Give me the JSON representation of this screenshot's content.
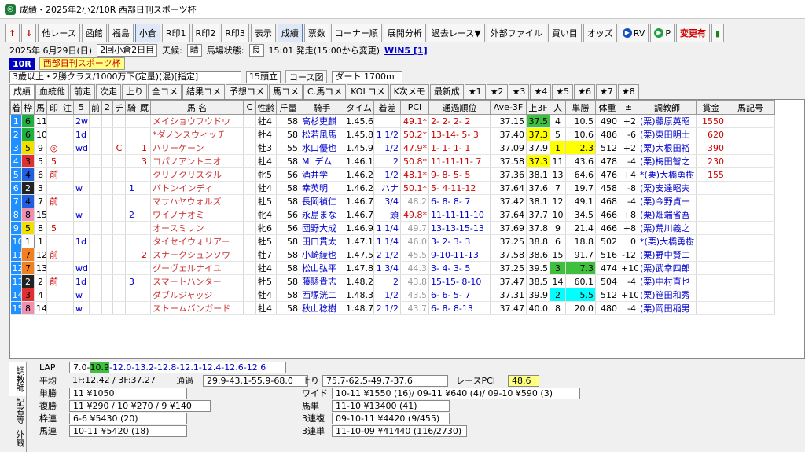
{
  "window": {
    "title": "成績・2025年2小2/10R 西部日刊スポーツ杯"
  },
  "toolbar": [
    {
      "id": "prev",
      "label": "↑",
      "icon": "up-arrow-icon"
    },
    {
      "id": "next",
      "label": "↓",
      "icon": "down-arrow-icon"
    },
    {
      "id": "other_race",
      "label": "他レース"
    },
    {
      "id": "hakodate",
      "label": "函館"
    },
    {
      "id": "fukushima",
      "label": "福島"
    },
    {
      "id": "kokura",
      "label": "小倉",
      "active": true
    },
    {
      "id": "rmark1",
      "label": "R印1"
    },
    {
      "id": "rmark2",
      "label": "R印2"
    },
    {
      "id": "rmark3",
      "label": "R印3"
    },
    {
      "id": "display",
      "label": "表示"
    },
    {
      "id": "results",
      "label": "成績",
      "active": true
    },
    {
      "id": "votes",
      "label": "票数"
    },
    {
      "id": "corner",
      "label": "コーナー順"
    },
    {
      "id": "pace",
      "label": "展開分析"
    },
    {
      "id": "past",
      "label": "過去レース▼"
    },
    {
      "id": "extfile",
      "label": "外部ファイル"
    },
    {
      "id": "buy",
      "label": "買い目"
    },
    {
      "id": "odds",
      "label": "オッズ"
    },
    {
      "id": "rv",
      "label": "RV",
      "icon": "play-circle-icon"
    },
    {
      "id": "p",
      "label": "P",
      "icon": "play-green-icon"
    },
    {
      "id": "changed",
      "label": "変更有"
    },
    {
      "id": "flag",
      "label": "",
      "icon": "flag-icon"
    }
  ],
  "info": {
    "date": "2025年 6月29日(日)",
    "meeting": "2回小倉2日目",
    "weather_label": "天候:",
    "weather": "晴",
    "track_label": "馬場状態:",
    "track": "良",
    "start": "15:01 発走(15:00から変更)",
    "win5": "WIN5 [1]"
  },
  "race": {
    "no": "10R",
    "name": "西部日刊スポーツ杯",
    "cond": "3歳以上・2勝クラス/1000万下(定量)(混)[指定]",
    "runners": "15頭立",
    "course_btn": "コース図",
    "course": "ダート 1700m"
  },
  "tabs": [
    "成績",
    "血統他",
    "前走",
    "次走",
    "上り",
    "全コメ",
    "結果コメ",
    "予想コメ",
    "馬コメ",
    "C.馬コメ",
    "KOLコメ",
    "K次メモ",
    "最新成",
    "★1",
    "★2",
    "★3",
    "★4",
    "★5",
    "★6",
    "★7",
    "★8"
  ],
  "columns": [
    "着",
    "枠",
    "馬",
    "印",
    "注",
    "5",
    "前",
    "2",
    "チ",
    "騎",
    "厩",
    "馬 名",
    "C",
    "性齢",
    "斤量",
    "騎手",
    "タイム",
    "着差",
    "PCI",
    "通過順位",
    "Ave-3F",
    "上3F",
    "人",
    "単勝",
    "体重",
    "±",
    "調教師",
    "賞金",
    "馬記号"
  ],
  "rows": [
    [
      "1",
      "6",
      "11",
      "",
      "",
      "2w",
      "",
      "",
      "",
      "",
      "",
      "メイショウフウドウ",
      "",
      "牡4",
      "58",
      "高杉吏麒",
      "1.45.6",
      "",
      "49.1*",
      "2- 2- 2- 2",
      "37.15",
      "37.5",
      "4",
      "10.5",
      "490",
      "+2",
      "(栗)藤原英昭",
      "1550",
      ""
    ],
    [
      "2",
      "6",
      "10",
      "",
      "",
      "1d",
      "",
      "",
      "",
      "",
      "",
      "*ダノンスウィッチ",
      "",
      "牡4",
      "58",
      "松若風馬",
      "1.45.8",
      "1 1/2",
      "50.2*",
      "13-14- 5- 3",
      "37.40",
      "37.3",
      "5",
      "10.6",
      "486",
      "-6",
      "(栗)東田明士",
      "620",
      ""
    ],
    [
      "3",
      "5",
      "9",
      "◎",
      "",
      "wd",
      "",
      "",
      "C",
      "",
      "1",
      "ハリーケーン",
      "",
      "牡3",
      "55",
      "水口優也",
      "1.45.9",
      "1/2",
      "47.9*",
      "1- 1- 1- 1",
      "37.09",
      "37.9",
      "1",
      "2.3",
      "512",
      "+2",
      "(栗)大根田裕",
      "390",
      ""
    ],
    [
      "4",
      "3",
      "5",
      "5",
      "",
      "",
      "",
      "",
      "",
      "",
      "3",
      "コパノアントニオ",
      "",
      "牡4",
      "58",
      "M. デム",
      "1.46.1",
      "2",
      "50.8*",
      "11-11-11- 7",
      "37.58",
      "37.3",
      "11",
      "43.6",
      "478",
      "-4",
      "(栗)梅田智之",
      "230",
      ""
    ],
    [
      "5",
      "4",
      "6",
      "前",
      "",
      "",
      "",
      "",
      "",
      "",
      "",
      "クリノクリスタル",
      "",
      "牝5",
      "56",
      "酒井学",
      "1.46.2",
      "1/2",
      "48.1*",
      "9- 8- 5- 5",
      "37.36",
      "38.1",
      "13",
      "64.6",
      "476",
      "+4",
      "*(栗)大橋勇樹",
      "155",
      ""
    ],
    [
      "6",
      "2",
      "3",
      "",
      "",
      "w",
      "",
      "",
      "",
      "1",
      "",
      "バトンインディ",
      "",
      "牡4",
      "58",
      "幸英明",
      "1.46.2",
      "ハナ",
      "50.1*",
      "5- 4-11-12",
      "37.64",
      "37.6",
      "7",
      "19.7",
      "458",
      "-8",
      "(栗)安達昭夫",
      "",
      ""
    ],
    [
      "7",
      "4",
      "7",
      "前",
      "",
      "",
      "",
      "",
      "",
      "",
      "",
      "マサハヤウォルズ",
      "",
      "牡5",
      "58",
      "長岡禎仁",
      "1.46.7",
      "3/4",
      "48.2",
      "6- 8- 8- 7",
      "37.42",
      "38.1",
      "12",
      "49.1",
      "468",
      "-4",
      "(栗)今野貞一",
      "",
      ""
    ],
    [
      "8",
      "8",
      "15",
      "",
      "",
      "w",
      "",
      "",
      "",
      "2",
      "",
      "ワイノナオミ",
      "",
      "牝4",
      "56",
      "永島まな",
      "1.46.7",
      "頭",
      "49.8*",
      "11-11-11-10",
      "37.64",
      "37.7",
      "10",
      "34.5",
      "466",
      "+8",
      "(栗)畑端省吾",
      "",
      ""
    ],
    [
      "9",
      "5",
      "8",
      "5",
      "",
      "",
      "",
      "",
      "",
      "",
      "",
      "オースミリン",
      "",
      "牝6",
      "56",
      "団野大成",
      "1.46.9",
      "1 1/4",
      "49.7",
      "13-13-15-13",
      "37.69",
      "37.8",
      "9",
      "21.4",
      "466",
      "+8",
      "(栗)荒川義之",
      "",
      ""
    ],
    [
      "10",
      "1",
      "1",
      "",
      "",
      "1d",
      "",
      "",
      "",
      "",
      "",
      "タイセイウォリアー",
      "",
      "牡5",
      "58",
      "田口貫太",
      "1.47.1",
      "1 1/4",
      "46.0",
      "3- 2- 3- 3",
      "37.25",
      "38.8",
      "6",
      "18.8",
      "502",
      "0",
      "*(栗)大橋勇樹",
      "",
      ""
    ],
    [
      "11",
      "7",
      "12",
      "前",
      "",
      "",
      "",
      "",
      "",
      "",
      "2",
      "スナークシュンソウ",
      "",
      "牡7",
      "58",
      "小崎綾也",
      "1.47.5",
      "2 1/2",
      "45.5",
      "9-10-11-13",
      "37.58",
      "38.6",
      "15",
      "91.7",
      "516",
      "-12",
      "(栗)野中賢二",
      "",
      ""
    ],
    [
      "12",
      "7",
      "13",
      "",
      "",
      "wd",
      "",
      "",
      "",
      "",
      "",
      "グーヴェルナイユ",
      "",
      "牡4",
      "58",
      "松山弘平",
      "1.47.8",
      "1 3/4",
      "44.3",
      "3- 4- 3- 5",
      "37.25",
      "39.5",
      "3",
      "7.3",
      "474",
      "+10",
      "(栗)武幸四郎",
      "",
      ""
    ],
    [
      "13",
      "2",
      "2",
      "前",
      "",
      "1d",
      "",
      "",
      "",
      "3",
      "",
      "スマートハンター",
      "",
      "牡5",
      "58",
      "藤懸貴志",
      "1.48.2",
      "2",
      "43.8",
      "15-15- 8-10",
      "37.47",
      "38.5",
      "14",
      "60.1",
      "504",
      "-4",
      "(栗)中村直也",
      "",
      ""
    ],
    [
      "14",
      "3",
      "4",
      "",
      "",
      "w",
      "",
      "",
      "",
      "",
      "",
      "ダブルジャッジ",
      "",
      "牡4",
      "58",
      "西塚洸二",
      "1.48.3",
      "1/2",
      "43.5",
      "6- 6- 5- 7",
      "37.31",
      "39.9",
      "2",
      "5.5",
      "512",
      "+10",
      "(栗)笹田和秀",
      "",
      ""
    ],
    [
      "15",
      "8",
      "14",
      "",
      "",
      "w",
      "",
      "",
      "",
      "",
      "",
      "ストームバンガード",
      "",
      "牡4",
      "58",
      "秋山稔樹",
      "1.48.7",
      "2 1/2",
      "43.7",
      "6- 8- 8-13",
      "37.47",
      "40.0",
      "8",
      "20.0",
      "480",
      "-4",
      "(栗)岡田稲男",
      "",
      ""
    ]
  ],
  "lower": {
    "side_tabs": [
      "調教師",
      "記者等",
      "外厩"
    ],
    "lap_label": "LAP",
    "lap_pre": "7.0-",
    "lap_hl": "10.9",
    "lap_post": "-12.0-13.2-12.8-12.1-12.4-12.6-12.6",
    "avg_label": "平均",
    "avg": "1F:12.42 / 3F:37.27",
    "passing_label": "通過",
    "passing": "29.9-43.1-55.9-68.0",
    "up_label": "上り",
    "up": "75.7-62.5-49.7-37.6",
    "rpci_label": "レースPCI",
    "rpci": "48.6",
    "tansho_label": "単勝",
    "tansho": "11 ¥1050",
    "fukusho_label": "複勝",
    "fukusho": "11 ¥290 / 10 ¥270 / 9 ¥140",
    "wakuren_label": "枠連",
    "wakuren": "6-6 ¥5430 (20)",
    "umaren_label": "馬連",
    "umaren": "10-11 ¥5420 (18)",
    "wide_label": "ワイド",
    "wide": "10-11 ¥1550 (16)/ 09-11 ¥640 (4)/ 09-10 ¥590 (3)",
    "umatan_label": "馬単",
    "umatan": "11-10 ¥13400 (41)",
    "sanrenpuku_label": "3連複",
    "sanrenpuku": "09-10-11 ¥4420 (9/455)",
    "sanrentan_label": "3連単",
    "sanrentan": "11-10-09 ¥41440 (116/2730)"
  },
  "colors": {
    "frame": {
      "1": "#ffffff",
      "2": "#222222",
      "3": "#e03030",
      "4": "#2060e0",
      "5": "#f0e000",
      "6": "#20b040",
      "7": "#f08020",
      "8": "#f090b0"
    }
  }
}
